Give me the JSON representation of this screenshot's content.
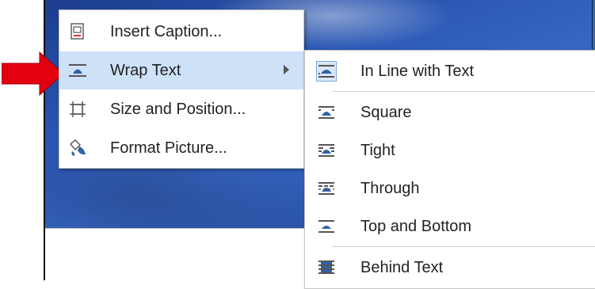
{
  "context_menu": {
    "items": [
      {
        "label": "Insert Caption...",
        "icon": "insert-caption-icon"
      },
      {
        "label": "Wrap Text",
        "icon": "wrap-text-icon",
        "has_submenu": true,
        "highlighted": true
      },
      {
        "label": "Size and Position...",
        "icon": "size-position-icon"
      },
      {
        "label": "Format Picture...",
        "icon": "format-picture-icon"
      }
    ]
  },
  "wrap_submenu": {
    "items": [
      {
        "label": "In Line with Text",
        "icon": "inline-with-text-icon",
        "selected": true
      },
      {
        "label": "Square",
        "icon": "square-wrap-icon"
      },
      {
        "label": "Tight",
        "icon": "tight-wrap-icon"
      },
      {
        "label": "Through",
        "icon": "through-wrap-icon"
      },
      {
        "label": "Top and Bottom",
        "icon": "top-bottom-wrap-icon"
      },
      {
        "label": "Behind Text",
        "icon": "behind-text-icon"
      }
    ]
  },
  "colors": {
    "highlight": "#cde1f7",
    "arrow": "#e3000f",
    "icon_blue": "#2e63a8"
  }
}
